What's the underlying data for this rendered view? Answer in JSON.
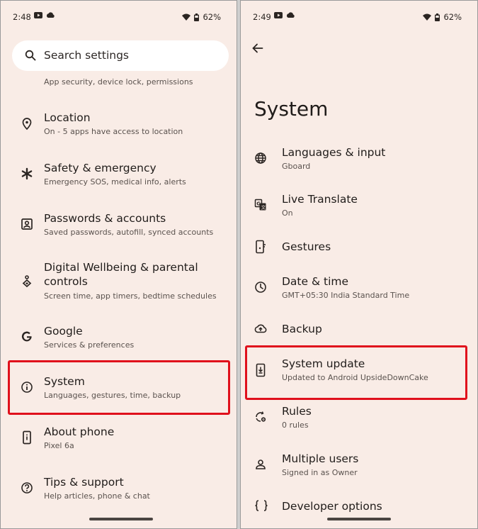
{
  "left_panel": {
    "status": {
      "time": "2:48",
      "battery": "62%"
    },
    "search": {
      "placeholder": "Search settings"
    },
    "peek_text": "App security, device lock, permissions",
    "items": [
      {
        "title": "Location",
        "subtitle": "On - 5 apps have access to location",
        "icon": "location-pin-icon"
      },
      {
        "title": "Safety & emergency",
        "subtitle": "Emergency SOS, medical info, alerts",
        "icon": "asterisk-icon"
      },
      {
        "title": "Passwords & accounts",
        "subtitle": "Saved passwords, autofill, synced accounts",
        "icon": "account-box-icon"
      },
      {
        "title_line1": "Digital Wellbeing & parental",
        "title_line2": "controls",
        "subtitle": "Screen time, app timers, bedtime schedules",
        "icon": "wellbeing-icon"
      },
      {
        "title": "Google",
        "subtitle": "Services & preferences",
        "icon": "google-g-icon"
      },
      {
        "title": "System",
        "subtitle": "Languages, gestures, time, backup",
        "icon": "info-icon",
        "highlighted": true
      },
      {
        "title": "About phone",
        "subtitle": "Pixel 6a",
        "icon": "phone-info-icon"
      },
      {
        "title": "Tips & support",
        "subtitle": "Help articles, phone & chat",
        "icon": "help-icon"
      }
    ]
  },
  "right_panel": {
    "status": {
      "time": "2:49",
      "battery": "62%"
    },
    "page_title": "System",
    "items": [
      {
        "title": "Languages & input",
        "subtitle": "Gboard",
        "icon": "globe-icon"
      },
      {
        "title": "Live Translate",
        "subtitle": "On",
        "icon": "translate-icon"
      },
      {
        "title": "Gestures",
        "subtitle": "",
        "icon": "gesture-phone-icon"
      },
      {
        "title": "Date & time",
        "subtitle": "GMT+05:30 India Standard Time",
        "icon": "clock-icon"
      },
      {
        "title": "Backup",
        "subtitle": "",
        "icon": "cloud-upload-icon"
      },
      {
        "title": "System update",
        "subtitle": "Updated to Android UpsideDownCake",
        "icon": "system-update-icon",
        "highlighted": true
      },
      {
        "title": "Rules",
        "subtitle": "0 rules",
        "icon": "rules-icon"
      },
      {
        "title": "Multiple users",
        "subtitle": "Signed in as Owner",
        "icon": "person-icon"
      },
      {
        "title": "Developer options",
        "subtitle": "",
        "icon": "braces-icon"
      }
    ]
  },
  "colors": {
    "background": "#f9ece6",
    "highlight": "#e0101c",
    "search_bg": "#ffffff"
  }
}
